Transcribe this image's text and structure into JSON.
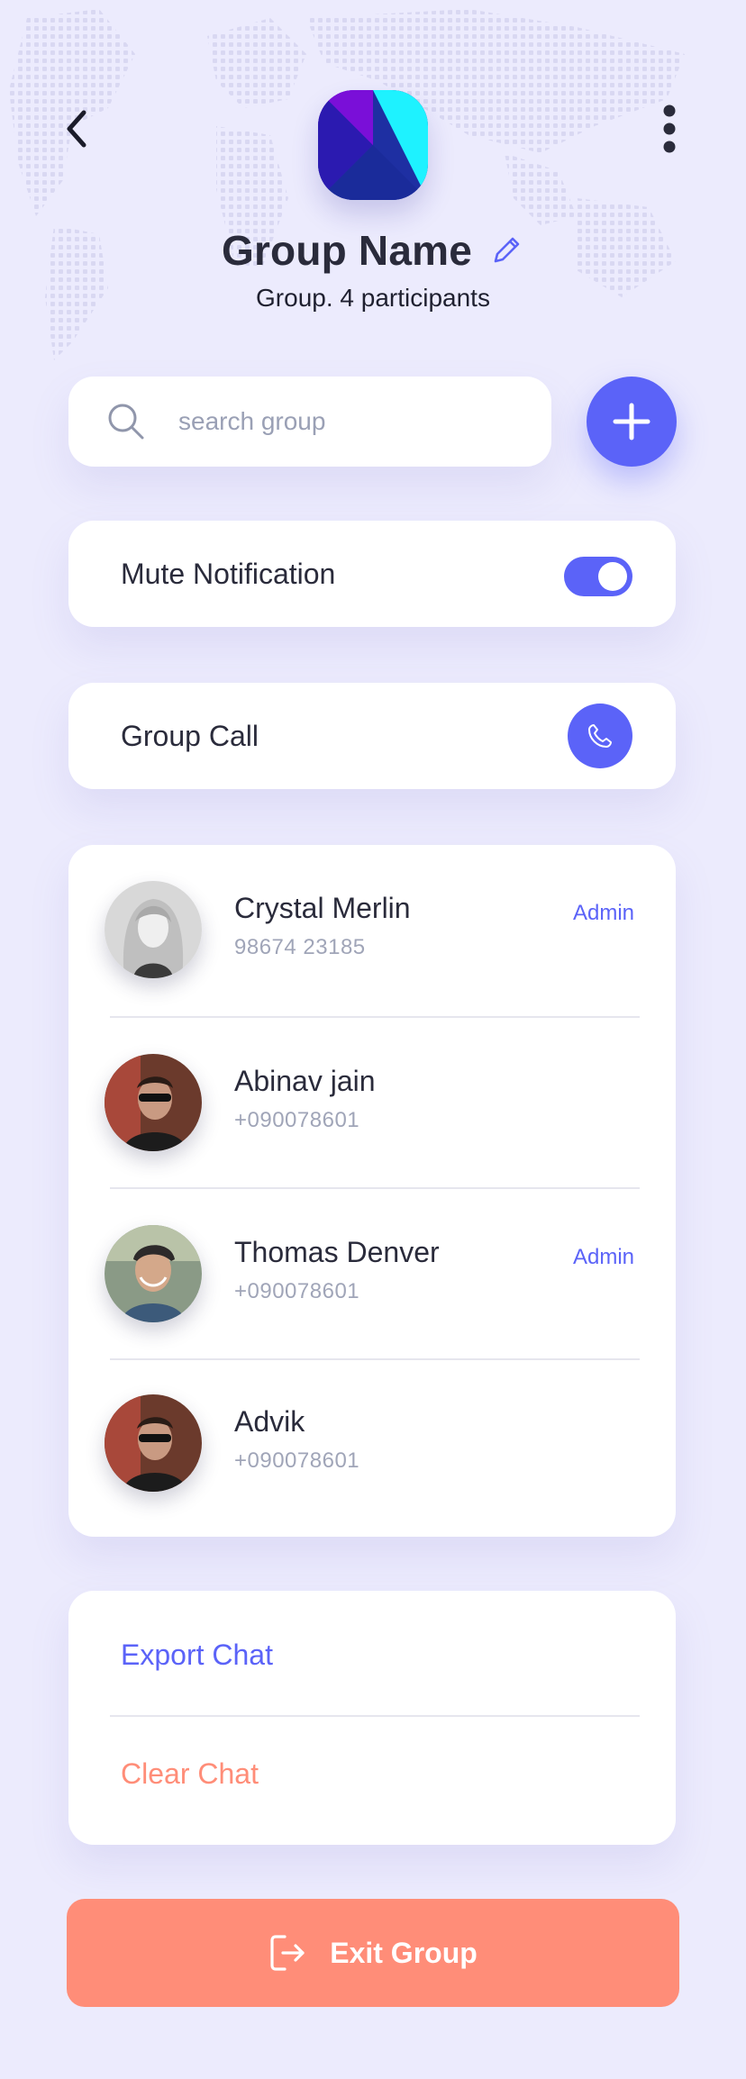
{
  "header": {
    "group_name": "Group Name",
    "subtitle": "Group. 4 participants"
  },
  "search": {
    "placeholder": "search group"
  },
  "settings": {
    "mute_label": "Mute Notification",
    "mute_enabled": true,
    "call_label": "Group Call"
  },
  "members": [
    {
      "name": "Crystal Merlin",
      "phone": "98674 23185",
      "role": "Admin"
    },
    {
      "name": "Abinav jain",
      "phone": "+090078601",
      "role": ""
    },
    {
      "name": "Thomas Denver",
      "phone": "+090078601",
      "role": "Admin"
    },
    {
      "name": "Advik",
      "phone": "+090078601",
      "role": ""
    }
  ],
  "actions": {
    "export_label": "Export Chat",
    "clear_label": "Clear Chat"
  },
  "exit_label": "Exit Group",
  "colors": {
    "accent": "#5B63F8",
    "danger": "#FF8D78",
    "background": "#ECEBFD"
  },
  "icons": [
    "back-arrow-icon",
    "more-vertical-icon",
    "group-logo",
    "edit-pencil-icon",
    "search-icon",
    "plus-icon",
    "phone-icon",
    "exit-door-icon"
  ]
}
